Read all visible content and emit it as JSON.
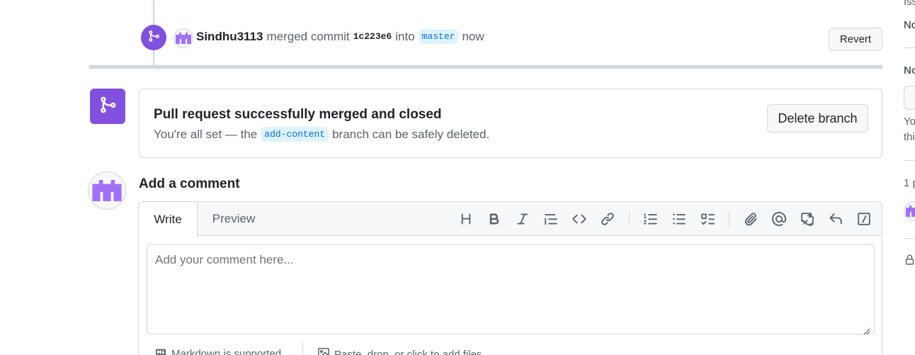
{
  "timeline_event": {
    "author": "Sindhu3113",
    "action": "merged commit",
    "commit_sha": "1c223e6",
    "into": "into",
    "target_branch": "master",
    "time": "now",
    "revert_label": "Revert"
  },
  "merge_status": {
    "title": "Pull request successfully merged and closed",
    "desc_prefix": "You're all set — the",
    "branch": "add-content",
    "desc_suffix": "branch can be safely deleted.",
    "delete_label": "Delete branch"
  },
  "comment": {
    "title": "Add a comment",
    "tabs": {
      "write": "Write",
      "preview": "Preview"
    },
    "placeholder": "Add your comment here...",
    "toolbar_icons": [
      "heading-icon",
      "bold-icon",
      "italic-icon",
      "quote-icon",
      "code-icon",
      "link-icon",
      "numbered-list-icon",
      "unordered-list-icon",
      "task-list-icon",
      "attach-icon",
      "mention-icon",
      "cross-reference-icon",
      "reply-icon",
      "slash-command-icon"
    ],
    "footer": {
      "markdown": "Markdown is supported",
      "attach": "Paste, drop, or click to add files"
    }
  },
  "sidebar": {
    "issues_fragment": "Iss",
    "none_fragment": "No",
    "notifications_fragment": "No",
    "notice_line1": "Yo",
    "notice_line2": "thi",
    "participants_fragment": "1 p"
  },
  "colors": {
    "merged_purple": "#8250df",
    "border": "#d0d7de",
    "muted_text": "#59636e",
    "branch_bg": "#ddf4ff",
    "branch_text": "#0969da"
  }
}
